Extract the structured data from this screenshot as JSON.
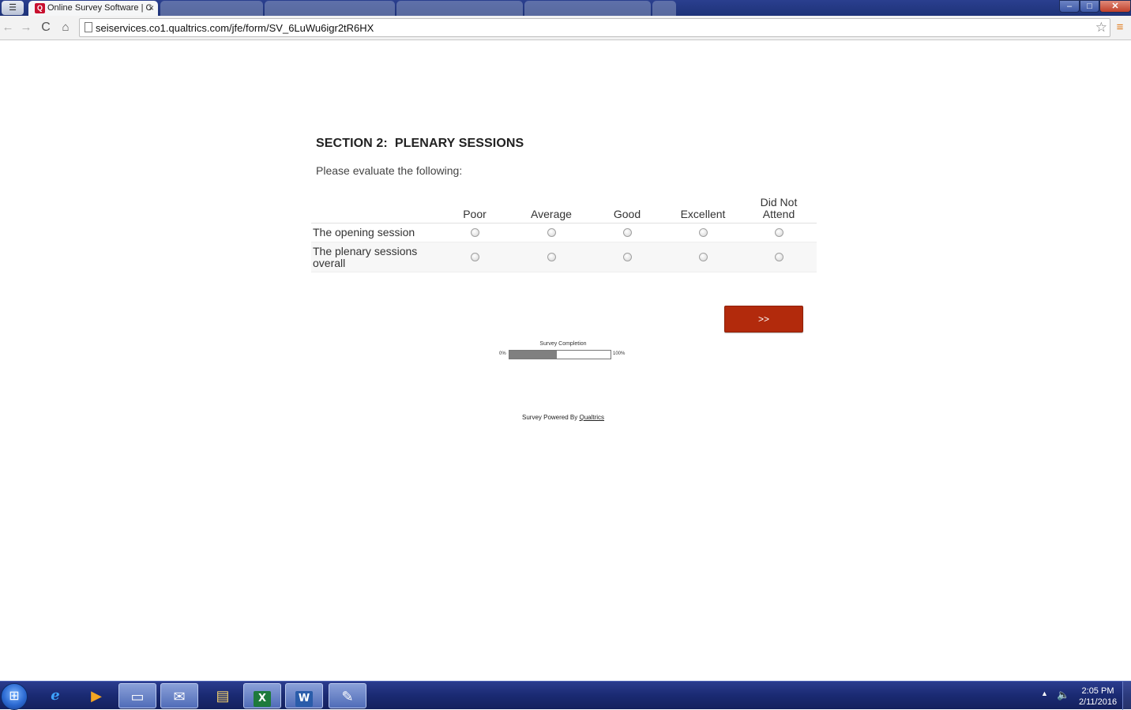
{
  "browser": {
    "active_tab_title": "Online Survey Software | C",
    "tab_close_glyph": "×",
    "url": "seiservices.co1.qualtrics.com/jfe/form/SV_6LuWu6igr2tR6HX",
    "window_controls": {
      "minimize": "–",
      "maximize": "□",
      "close": "✕"
    },
    "icons": {
      "back": "←",
      "forward": "→",
      "reload": "C",
      "home": "⌂",
      "bookmark": "☆",
      "menu": "≡"
    }
  },
  "survey": {
    "section_title": "SECTION 2:  PLENARY SESSIONS",
    "question_text": "Please evaluate the following:",
    "columns": [
      "Poor",
      "Average",
      "Good",
      "Excellent",
      "Did Not Attend"
    ],
    "rows": [
      {
        "label": "The opening session",
        "selected": null
      },
      {
        "label": "The plenary sessions overall",
        "selected": null
      }
    ],
    "next_button_label": ">>",
    "progress": {
      "label": "Survey Completion",
      "min_label": "0%",
      "max_label": "100%",
      "fraction": 0.47
    },
    "footer": {
      "powered_by_text": "Survey Powered By ",
      "link_text": "Qualtrics"
    }
  },
  "taskbar": {
    "start_icon": "⊞",
    "items": [
      {
        "name": "internet-explorer",
        "glyph": "e"
      },
      {
        "name": "media-player",
        "glyph": "▶"
      },
      {
        "name": "app-window",
        "glyph": "▭"
      },
      {
        "name": "outlook",
        "glyph": "✉"
      },
      {
        "name": "file-explorer",
        "glyph": "▤"
      },
      {
        "name": "excel",
        "glyph": "X"
      },
      {
        "name": "word",
        "glyph": "W"
      },
      {
        "name": "paint",
        "glyph": "✎"
      }
    ],
    "tray_arrow": "▲",
    "volume_glyph": "🔈",
    "clock_time": "2:05 PM",
    "clock_date": "2/11/2016"
  },
  "colors": {
    "accent_button": "#b22a0c",
    "progress_fill": "#808080",
    "taskbar": "#1a2a72",
    "titlebar": "#2a3f8f"
  }
}
